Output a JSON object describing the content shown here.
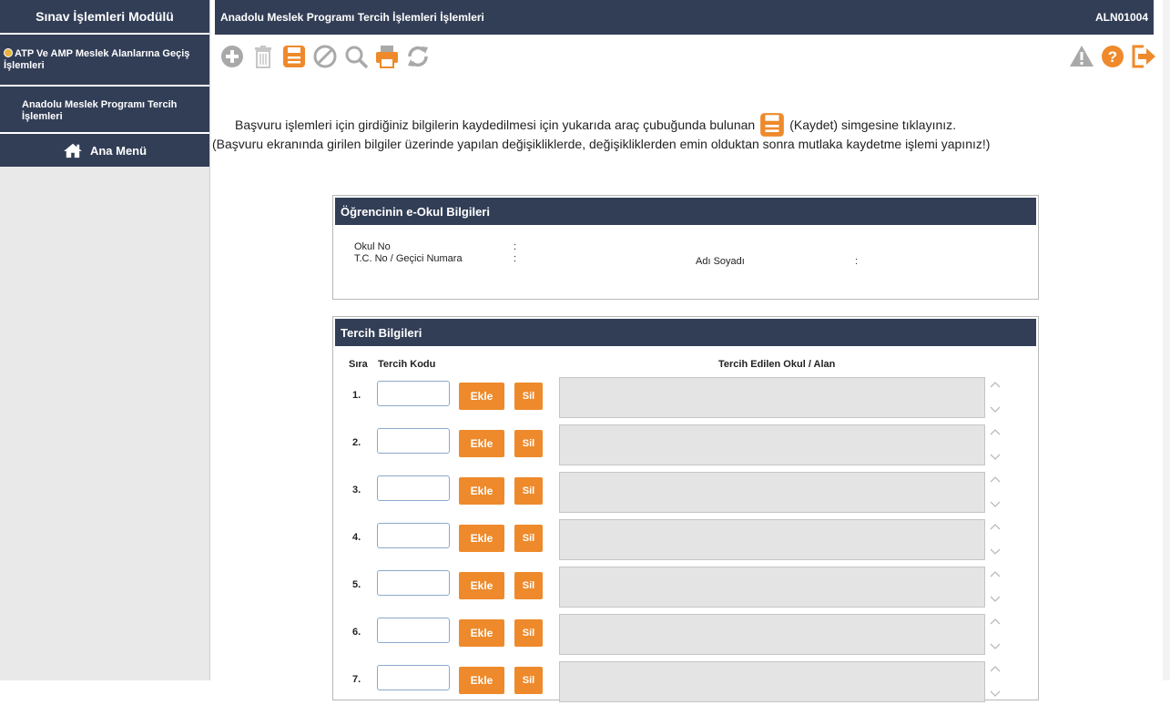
{
  "sidebar": {
    "title": "Sınav İşlemleri Modülü",
    "items": [
      {
        "label": "ATP Ve AMP Meslek Alanlarına Geçiş İşlemleri"
      },
      {
        "label": "Anadolu Meslek Programı Tercih İşlemleri"
      }
    ],
    "home_label": "Ana Menü"
  },
  "header": {
    "title": "Anadolu Meslek Programı Tercih İşlemleri İşlemleri",
    "code": "ALN01004"
  },
  "toolbar": {
    "left_icons": [
      "add-icon",
      "delete-icon",
      "save-icon",
      "cancel-icon",
      "search-icon",
      "print-icon",
      "refresh-icon"
    ],
    "right_icons": [
      "warning-icon",
      "help-icon",
      "exit-icon"
    ]
  },
  "info": {
    "line1_before": "Başvuru işlemleri için girdiğiniz bilgilerin kaydedilmesi için yukarıda araç çubuğunda bulunan",
    "line1_after": "(Kaydet) simgesine tıklayınız.",
    "line2": "(Başvuru ekranında girilen bilgiler üzerinde yapılan değişikliklerde, değişikliklerden emin olduktan sonra mutlaka kaydetme işlemi yapınız!)"
  },
  "student_panel": {
    "title": "Öğrencinin  e-Okul Bilgileri",
    "okul_no_label": "Okul No",
    "tc_label": "T.C. No / Geçici Numara",
    "adsoyad_label": "Adı Soyadı",
    "colon": ":"
  },
  "choices_panel": {
    "title": "Tercih Bilgileri",
    "col_sira": "Sıra",
    "col_kodu": "Tercih Kodu",
    "col_okul": "Tercih Edilen Okul / Alan",
    "add_label": "Ekle",
    "remove_label": "Sil",
    "rows": [
      "1.",
      "2.",
      "3.",
      "4.",
      "5.",
      "6.",
      "7."
    ]
  },
  "colors": {
    "navy": "#323e56",
    "orange": "#ee8a2b",
    "gray_icon": "#a9a9a9"
  }
}
